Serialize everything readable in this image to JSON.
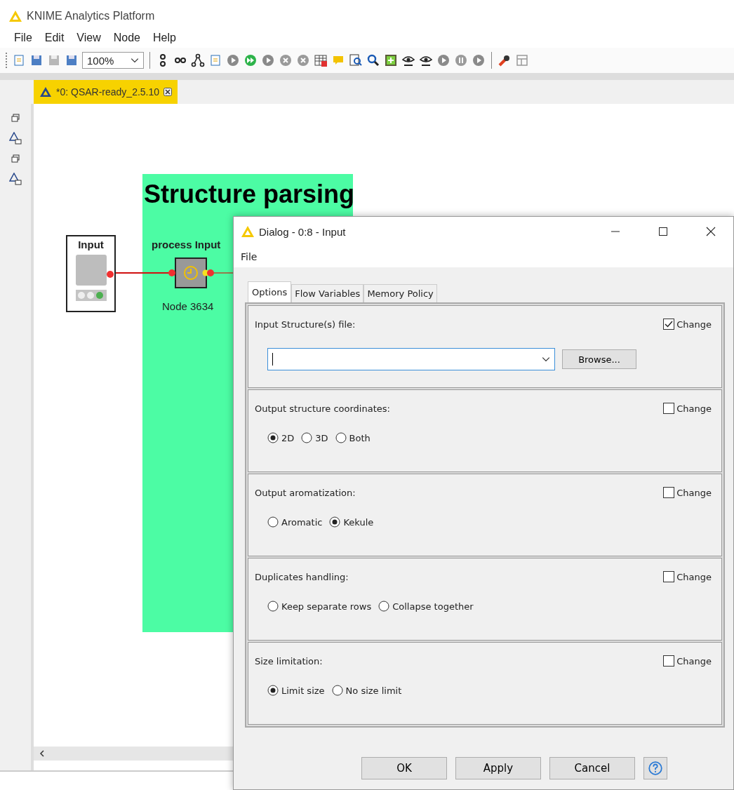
{
  "app": {
    "title": "KNIME Analytics Platform"
  },
  "menu": [
    "File",
    "Edit",
    "View",
    "Node",
    "Help"
  ],
  "toolbar": {
    "zoom": "100%"
  },
  "editor_tab": {
    "label": "*0: QSAR-ready_2.5.10",
    "selected": true
  },
  "workflow": {
    "annotation": {
      "title": "Structure parsing"
    },
    "nodes": [
      {
        "kind": "source",
        "title": "Input"
      },
      {
        "kind": "metanode",
        "title": "process Input",
        "label": "Node 3634"
      }
    ]
  },
  "dialog": {
    "title": "Dialog - 0:8 - Input",
    "menu": [
      "File"
    ],
    "tabs": [
      {
        "label": "Options",
        "selected": true
      },
      {
        "label": "Flow Variables",
        "selected": false
      },
      {
        "label": "Memory Policy",
        "selected": false
      }
    ],
    "sections": [
      {
        "kind": "file",
        "label": "Input Structure(s) file:",
        "change": "Change",
        "change_checked": true,
        "button": "Browse..."
      },
      {
        "kind": "radio",
        "label": "Output structure coordinates:",
        "change": "Change",
        "change_checked": false,
        "options": [
          {
            "label": "2D",
            "selected": true
          },
          {
            "label": "3D",
            "selected": false
          },
          {
            "label": "Both",
            "selected": false
          }
        ]
      },
      {
        "kind": "radio",
        "label": "Output aromatization:",
        "change": "Change",
        "change_checked": false,
        "options": [
          {
            "label": "Aromatic",
            "selected": false
          },
          {
            "label": "Kekule",
            "selected": true
          }
        ]
      },
      {
        "kind": "radio",
        "label": "Duplicates handling:",
        "change": "Change",
        "change_checked": false,
        "options": [
          {
            "label": "Keep separate rows",
            "selected": false
          },
          {
            "label": "Collapse together",
            "selected": false
          }
        ]
      },
      {
        "kind": "radio",
        "label": "Size limitation:",
        "change": "Change",
        "change_checked": false,
        "options": [
          {
            "label": "Limit size",
            "selected": true
          },
          {
            "label": "No size limit",
            "selected": false
          }
        ]
      }
    ],
    "buttons": [
      "OK",
      "Apply",
      "Cancel"
    ]
  }
}
